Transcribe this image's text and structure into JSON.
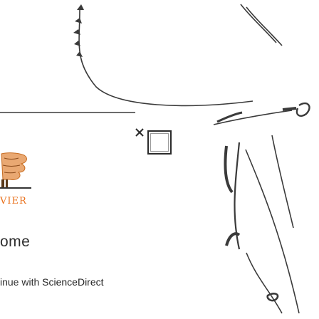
{
  "publisher": {
    "name_visible": "VIER",
    "logo_icon": "tree-logo-icon"
  },
  "welcome": {
    "heading_visible": "ome"
  },
  "continue": {
    "prefix": "inue with ",
    "brand": "ScienceDirect"
  },
  "dialog": {
    "close_icon": "close-icon",
    "checkbox_checked": false
  },
  "colors": {
    "publisher_orange": "#e9711c",
    "text_dark": "#2e2e2e",
    "line_art": "#3a3a3a",
    "background": "#ffffff"
  }
}
